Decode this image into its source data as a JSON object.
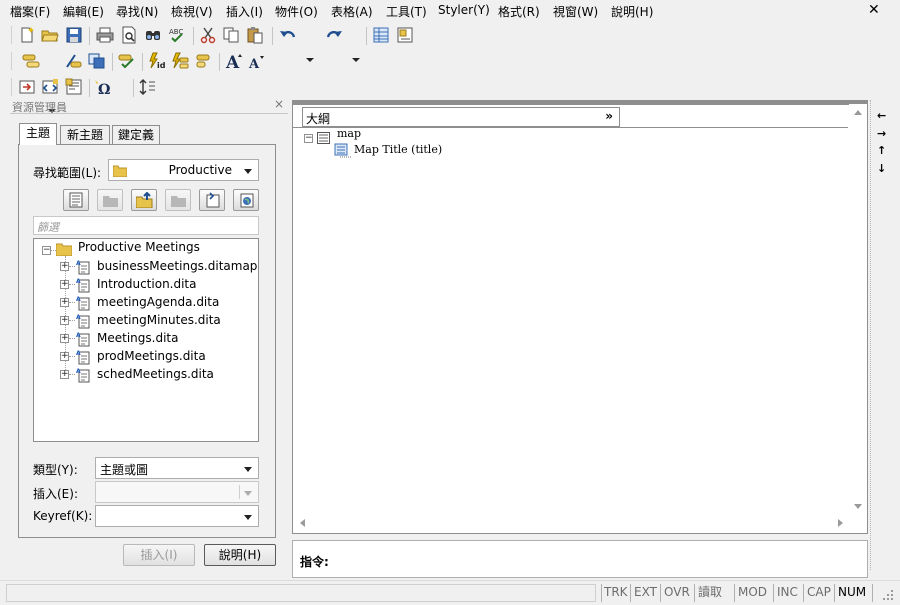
{
  "menu": {
    "items": [
      "檔案(F)",
      "編輯(E)",
      "尋找(N)",
      "檢視(V)",
      "插入(I)",
      "物件(O)",
      "表格(A)",
      "工具(T)",
      "Styler(Y)",
      "格式(R)",
      "視窗(W)",
      "說明(H)"
    ]
  },
  "window": {
    "close_glyph": "✕"
  },
  "resource_manager": {
    "title": "資源管理員",
    "close_glyph": "×",
    "tabs": [
      "主題",
      "新主題",
      "鍵定義"
    ],
    "search_scope_label": "尋找範圍(L):",
    "search_scope_value": "Productive",
    "filter_placeholder": "篩選",
    "tree": {
      "root": "Productive Meetings",
      "children": [
        "businessMeetings.ditamap",
        "Introduction.dita",
        "meetingAgenda.dita",
        "meetingMinutes.dita",
        "Meetings.dita",
        "prodMeetings.dita",
        "schedMeetings.dita"
      ]
    },
    "type_label": "類型(Y):",
    "type_value": "主題或圖",
    "insert_label": "插入(E):",
    "insert_value": "",
    "keyref_label": "Keyref(K):",
    "keyref_value": "",
    "insert_button": "插入(I)",
    "help_button": "說明(H)"
  },
  "outline": {
    "tab_title": "大綱",
    "tab_chevron": "»",
    "nodes": {
      "root": "map",
      "child": "Map Title (title)"
    }
  },
  "command": {
    "label": "指令:"
  },
  "side_arrows": [
    "←",
    "→",
    "↑",
    "↓"
  ],
  "status": {
    "cells": [
      {
        "text": "TRK",
        "on": false
      },
      {
        "text": "EXT",
        "on": false
      },
      {
        "text": "OVR",
        "on": false
      },
      {
        "text": "讀取",
        "on": false
      },
      {
        "text": "MOD",
        "on": false
      },
      {
        "text": "INC",
        "on": false
      },
      {
        "text": "CAP",
        "on": false
      },
      {
        "text": "NUM",
        "on": true
      }
    ]
  },
  "colors": {
    "folder": "#e8c34a",
    "accent_blue": "#1f5fbf",
    "panel_bg": "#f0f0f0"
  },
  "icons": {
    "toolbar1": [
      "new-doc-icon",
      "open-folder-icon",
      "save-icon",
      "print-icon",
      "print-preview-icon",
      "find-icon",
      "spellcheck-icon",
      "cut-icon",
      "copy-icon",
      "paste-icon",
      "undo-icon",
      "redo-icon",
      "table-icon",
      "frame-icon"
    ],
    "toolbar2": [
      "insert-element-icon",
      "change-element-icon",
      "split-element-icon",
      "validate-icon",
      "id-icon",
      "style-icon",
      "font-larger-icon",
      "font-smaller-icon"
    ],
    "toolbar3": [
      "xref-icon",
      "link-icon",
      "image-icon",
      "special-char-icon",
      "sort-icon"
    ]
  }
}
